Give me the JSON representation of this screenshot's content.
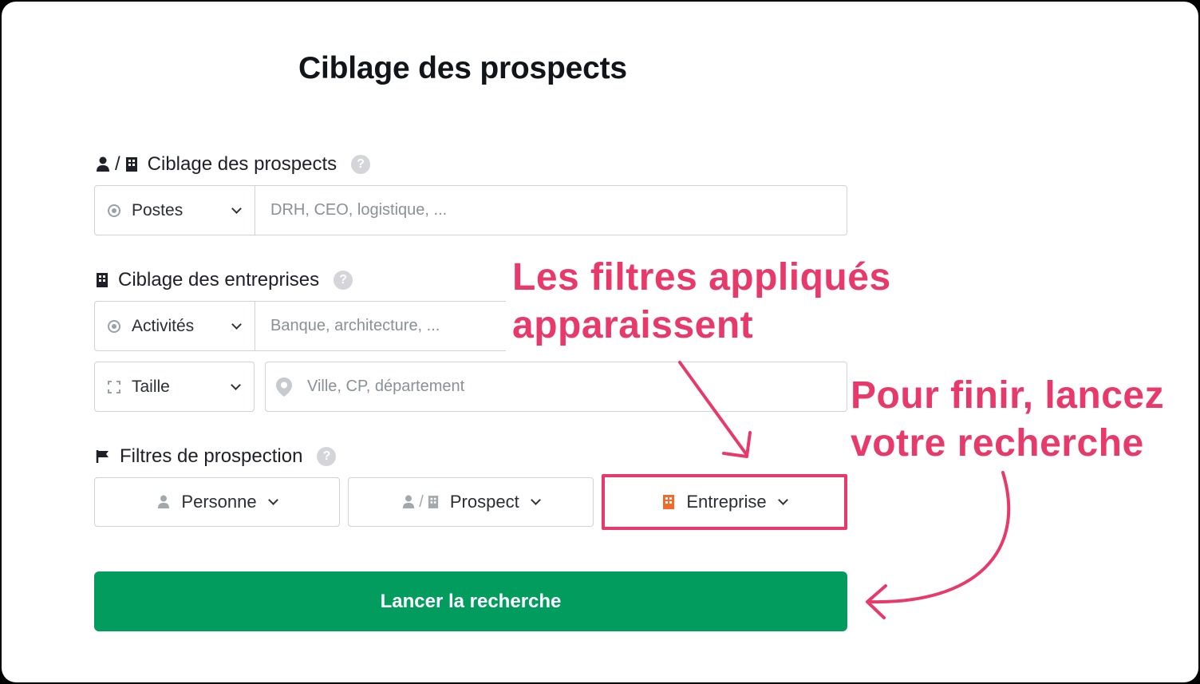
{
  "title": "Ciblage des prospects",
  "sections": {
    "prospects": {
      "label": "Ciblage des prospects",
      "select_label": "Postes",
      "input_placeholder": "DRH, CEO, logistique, ..."
    },
    "companies": {
      "label": "Ciblage des entreprises",
      "activity_select": "Activités",
      "activity_placeholder": "Banque, architecture, ...",
      "size_select": "Taille",
      "location_placeholder": "Ville, CP, département"
    },
    "filters": {
      "label": "Filtres de prospection",
      "buttons": [
        "Personne",
        "Prospect",
        "Entreprise"
      ]
    }
  },
  "help_glyph": "?",
  "separator": "/",
  "launch_button": "Lancer la recherche",
  "annotations": {
    "filters_note": [
      "Les filtres appliqués",
      "apparaissent"
    ],
    "launch_note": [
      "Pour finir, lancez",
      "votre recherche"
    ]
  },
  "colors": {
    "primary_green": "#019c5e",
    "annotation_pink": "#e83a6a",
    "highlight_icon_orange": "#f26b2a"
  }
}
